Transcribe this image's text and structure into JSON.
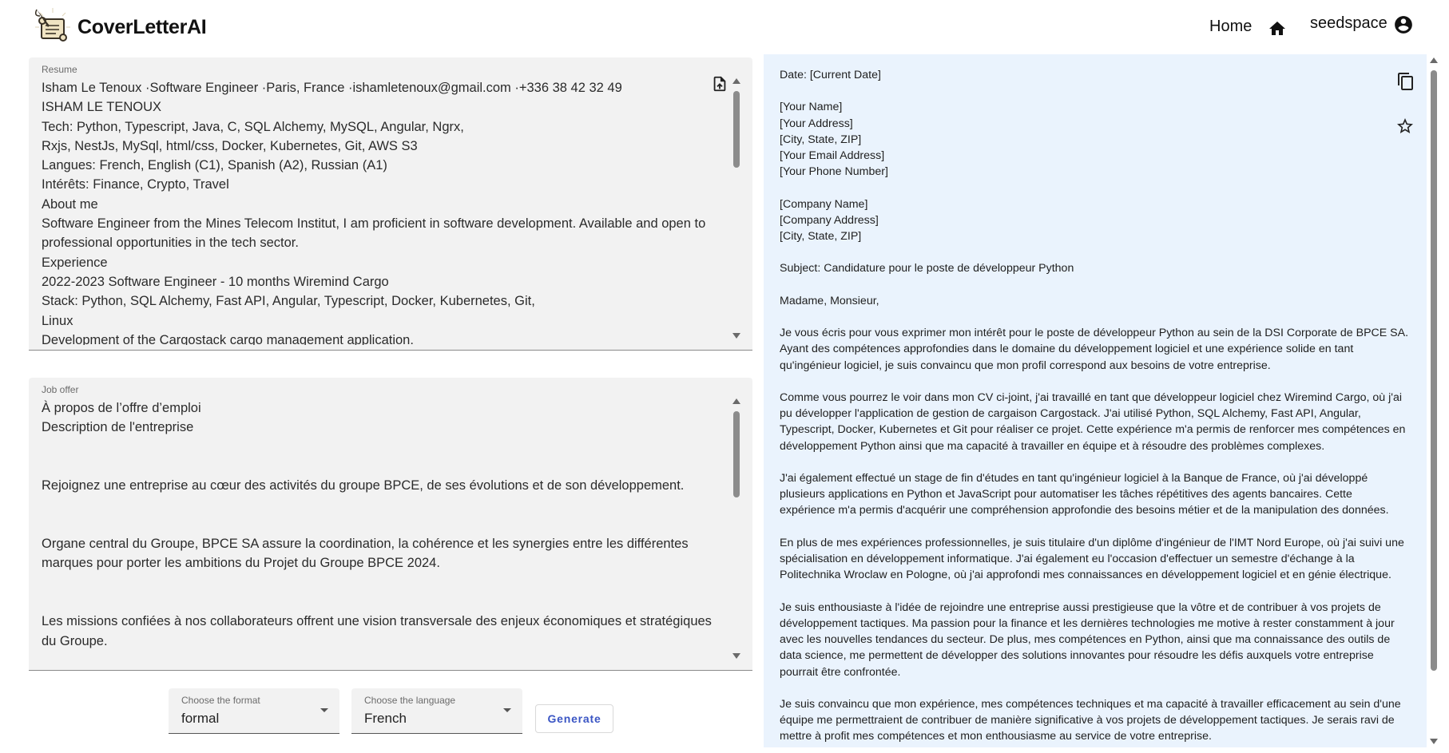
{
  "app": {
    "title": "CoverLetterAI",
    "nav_home": "Home",
    "user": "seedspace"
  },
  "resume": {
    "label": "Resume",
    "text": "Isham Le Tenoux ·Software Engineer ·Paris, France ·ishamletenoux@gmail.com ·+336 38 42 32 49\nISHAM LE TENOUX\nTech: Python, Typescript, Java, C, SQL Alchemy, MySQL, Angular, Ngrx,\nRxjs, NestJs, MySql, html/css, Docker, Kubernetes, Git, AWS S3\nLangues: French, English (C1), Spanish (A2), Russian (A1)\nIntérêts: Finance, Crypto, Travel\nAbout me\nSoftware Engineer from the Mines Telecom Institut, I am proficient in software development. Available and open to professional opportunities in the tech sector.\nExperience\n2022-2023 Software Engineer - 10 months Wiremind Cargo\nStack: Python, SQL Alchemy, Fast API, Angular, Typescript, Docker, Kubernetes, Git,\nLinux\nDevelopment of the Cargostack cargo management application."
  },
  "job_offer": {
    "label": "Job offer",
    "text": "À propos de l’offre d’emploi\nDescription de l'entreprise\n\n\nRejoignez une entreprise au cœur des activités du groupe BPCE, de ses évolutions et de son développement.\n\n\nOrgane central du Groupe, BPCE SA assure la coordination, la cohérence et les synergies entre les différentes marques pour porter les ambitions du Projet du Groupe BPCE 2024.\n\n\nLes missions confiées à nos collaborateurs offrent une vision transversale des enjeux économiques et stratégiques du Groupe."
  },
  "format_select": {
    "label": "Choose the format",
    "value": "formal"
  },
  "language_select": {
    "label": "Choose the language",
    "value": "French"
  },
  "generate_label": "Generate",
  "letter": {
    "text": "Date: [Current Date]\n\n[Your Name]\n[Your Address]\n[City, State, ZIP]\n[Your Email Address]\n[Your Phone Number]\n\n[Company Name]\n[Company Address]\n[City, State, ZIP]\n\nSubject: Candidature pour le poste de développeur Python\n\nMadame, Monsieur,\n\nJe vous écris pour vous exprimer mon intérêt pour le poste de développeur Python au sein de la DSI Corporate de BPCE SA. Ayant des compétences approfondies dans le domaine du développement logiciel et une expérience solide en tant qu'ingénieur logiciel, je suis convaincu que mon profil correspond aux besoins de votre entreprise.\n\nComme vous pourrez le voir dans mon CV ci-joint, j'ai travaillé en tant que développeur logiciel chez Wiremind Cargo, où j'ai pu développer l'application de gestion de cargaison Cargostack. J'ai utilisé Python, SQL Alchemy, Fast API, Angular, Typescript, Docker, Kubernetes et Git pour réaliser ce projet. Cette expérience m'a permis de renforcer mes compétences en développement Python ainsi que ma capacité à travailler en équipe et à résoudre des problèmes complexes.\n\nJ'ai également effectué un stage de fin d'études en tant qu'ingénieur logiciel à la Banque de France, où j'ai développé plusieurs applications en Python et JavaScript pour automatiser les tâches répétitives des agents bancaires. Cette expérience m'a permis d'acquérir une compréhension approfondie des besoins métier et de la manipulation des données.\n\nEn plus de mes expériences professionnelles, je suis titulaire d'un diplôme d'ingénieur de l'IMT Nord Europe, où j'ai suivi une spécialisation en développement informatique. J'ai également eu l'occasion d'effectuer un semestre d'échange à la Politechnika Wroclaw en Pologne, où j'ai approfondi mes connaissances en développement logiciel et en génie électrique.\n\nJe suis enthousiaste à l'idée de rejoindre une entreprise aussi prestigieuse que la vôtre et de contribuer à vos projets de développement tactiques. Ma passion pour la finance et les dernières technologies me motive à rester constamment à jour avec les nouvelles tendances du secteur. De plus, mes compétences en Python, ainsi que ma connaissance des outils de data science, me permettent de développer des solutions innovantes pour résoudre les défis auxquels votre entreprise pourrait être confrontée.\n\nJe suis convaincu que mon expérience, mes compétences techniques et ma capacité à travailler efficacement au sein d'une équipe me permettraient de contribuer de manière significative à vos projets de développement tactiques. Je serais ravi de mettre à profit mes compétences et mon enthousiasme au service de votre entreprise."
  },
  "icons": {
    "logo": "scroll-quill-logo",
    "home": "home-icon",
    "account": "account-circle-icon",
    "upload": "upload-file-icon",
    "copy": "copy-icon",
    "star": "star-outline-icon",
    "dropdown": "chevron-down-icon"
  },
  "colors": {
    "accent": "#3a55c4",
    "letter_background": "#eaf3fd",
    "field_background": "#f2f2f2"
  }
}
